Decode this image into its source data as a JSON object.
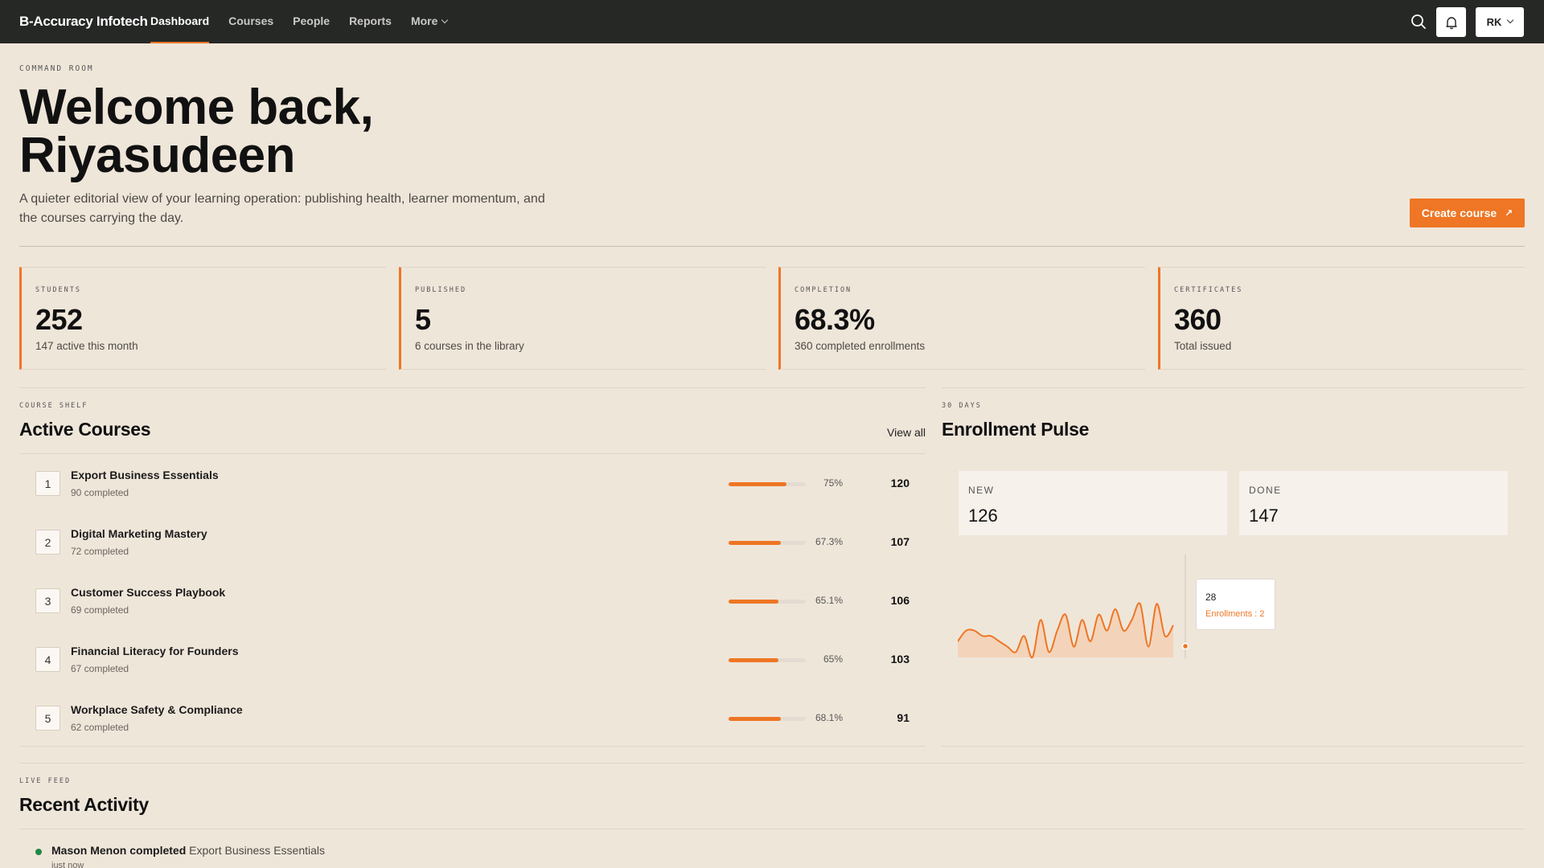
{
  "nav": {
    "brand": "B-Accuracy Infotech",
    "links": [
      "Dashboard",
      "Courses",
      "People",
      "Reports",
      "More"
    ],
    "active": "Dashboard",
    "avatar_initials": "RK",
    "icons": {
      "search": "search-icon",
      "notifications": "bell-icon"
    }
  },
  "hero": {
    "eyebrow": "COMMAND ROOM",
    "title_line1": "Welcome back,",
    "title_line2": "Riyasudeen",
    "subtitle": "A quieter editorial view of your learning operation: publishing health, learner momentum, and the courses carrying the day.",
    "create_label": "Create course",
    "create_icon": "arrow-up-right-icon"
  },
  "stats": [
    {
      "label": "STUDENTS",
      "value": "252",
      "sub": "147 active this month"
    },
    {
      "label": "PUBLISHED",
      "value": "5",
      "sub": "6 courses in the library"
    },
    {
      "label": "COMPLETION",
      "value": "68.3%",
      "sub": "360 completed enrollments"
    },
    {
      "label": "CERTIFICATES",
      "value": "360",
      "sub": "Total issued"
    }
  ],
  "courses": {
    "eyebrow": "COURSE SHELF",
    "title": "Active Courses",
    "view_all": "View all",
    "items": [
      {
        "rank": "1",
        "name": "Export Business Essentials",
        "completed": "90 completed",
        "progress": 0.75,
        "pct": "75%",
        "count": "120"
      },
      {
        "rank": "2",
        "name": "Digital Marketing Mastery",
        "completed": "72 completed",
        "progress": 0.673,
        "pct": "67.3%",
        "count": "107"
      },
      {
        "rank": "3",
        "name": "Customer Success Playbook",
        "completed": "69 completed",
        "progress": 0.651,
        "pct": "65.1%",
        "count": "106"
      },
      {
        "rank": "4",
        "name": "Financial Literacy for Founders",
        "completed": "67 completed",
        "progress": 0.65,
        "pct": "65%",
        "count": "103"
      },
      {
        "rank": "5",
        "name": "Workplace Safety & Compliance",
        "completed": "62 completed",
        "progress": 0.681,
        "pct": "68.1%",
        "count": "91"
      }
    ]
  },
  "enrollment": {
    "eyebrow": "30 DAYS",
    "title": "Enrollment Pulse",
    "new_label": "NEW",
    "new_value": "126",
    "done_label": "DONE",
    "done_value": "147",
    "tooltip": {
      "x": "28",
      "text": "Enrollments : 2"
    }
  },
  "chart_data": {
    "type": "area",
    "x": [
      1,
      2,
      3,
      4,
      5,
      6,
      7,
      8,
      9,
      10,
      11,
      12,
      13,
      14,
      15,
      16,
      17,
      18,
      19,
      20,
      21,
      22,
      23,
      24,
      25,
      26,
      27,
      28
    ],
    "values": [
      3,
      5,
      5,
      4,
      4,
      3,
      2,
      1,
      4,
      0,
      7,
      1,
      5,
      8,
      2,
      7,
      3,
      8,
      5,
      9,
      5,
      7,
      10,
      2,
      10,
      4,
      6,
      2
    ],
    "accent": "#ee7624",
    "fill": "#f4cfb3",
    "highlight_index": 27
  },
  "activity": {
    "eyebrow": "LIVE FEED",
    "title": "Recent Activity",
    "items": [
      {
        "who": "Mason Menon",
        "verb": "completed",
        "course": "Export Business Essentials",
        "time": "just now",
        "status_color": "#1e8a45"
      }
    ]
  }
}
